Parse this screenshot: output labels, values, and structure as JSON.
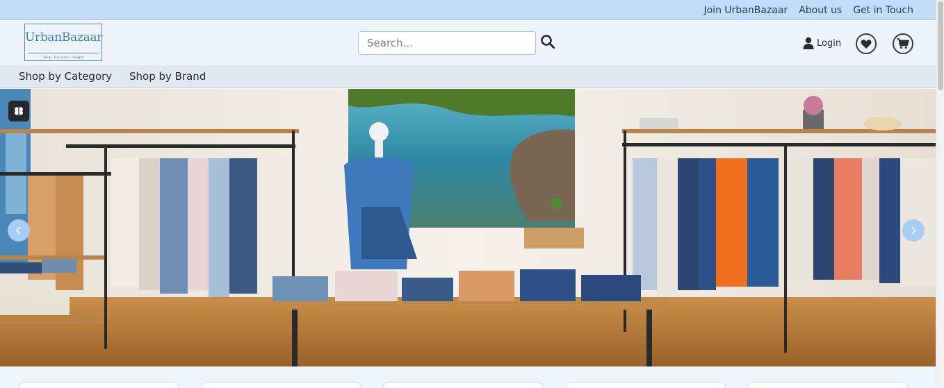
{
  "topbar": {
    "links": [
      "Join UrbanBazaar",
      "About us",
      "Get in Touch"
    ]
  },
  "header": {
    "logo_name": "UrbanBazaar",
    "logo_tagline": "Shop. Discover. Delight",
    "search_placeholder": "Search...",
    "login_label": "Login",
    "icons": [
      "search-icon",
      "user-icon",
      "heart-icon",
      "cart-icon"
    ]
  },
  "nav": {
    "items": [
      "Shop by Category",
      "Shop by Brand"
    ]
  },
  "hero": {
    "icons": [
      "chevron-left-icon",
      "chevron-right-icon",
      "brain-icon"
    ]
  },
  "colors": {
    "topbar_bg": "#c0dcf8",
    "header_bg": "#eef3f9",
    "nav_bg": "#e2e8f0",
    "logo_blue": "#3b86aa",
    "arrow_bg": "#a8cdf2"
  }
}
